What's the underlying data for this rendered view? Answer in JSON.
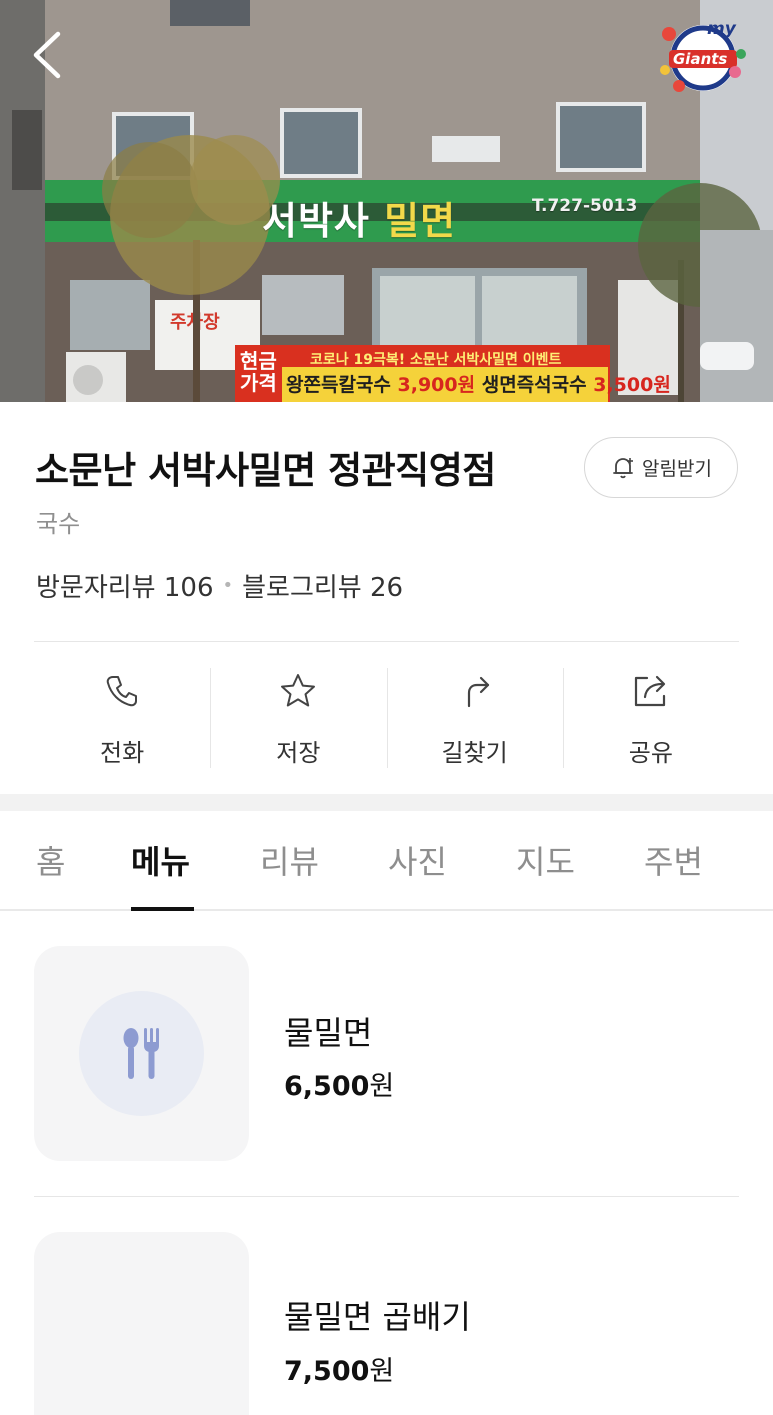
{
  "hero": {
    "sign_name_part1": "서박사 ",
    "sign_name_part2": "밀면",
    "sign_phone": "T.727-5013",
    "banner_top": "코로나 19극복! 소문난 서박사밀면 이벤트",
    "banner_item1": "왕쫀득칼국수 ",
    "banner_price1": "3,900원",
    "banner_item2": "  생면즉석국수 ",
    "banner_price2": "3,500원",
    "banner_cash": "현금 가격",
    "badge_text_top": "my",
    "badge_text_main": "Giants",
    "back_icon": "chevron-left-icon"
  },
  "store": {
    "name": "소문난 서박사밀면 정관직영점",
    "category": "국수",
    "visitor_reviews": "방문자리뷰 106",
    "separator": "•",
    "blog_reviews": "블로그리뷰 26",
    "notify_label": "알림받기",
    "notify_icon": "bell-plus-icon"
  },
  "actions": [
    {
      "label": "전화",
      "icon": "phone-icon"
    },
    {
      "label": "저장",
      "icon": "star-icon"
    },
    {
      "label": "길찾기",
      "icon": "directions-arrow-icon"
    },
    {
      "label": "공유",
      "icon": "share-icon"
    }
  ],
  "tabs": [
    {
      "label": "홈",
      "active": false
    },
    {
      "label": "메뉴",
      "active": true
    },
    {
      "label": "리뷰",
      "active": false
    },
    {
      "label": "사진",
      "active": false
    },
    {
      "label": "지도",
      "active": false
    },
    {
      "label": "주변",
      "active": false
    }
  ],
  "menu": [
    {
      "name": "물밀면",
      "price": "6,500",
      "currency": "원",
      "thumb_icon": "utensils-icon"
    },
    {
      "name": "물밀면 곱배기",
      "price": "7,500",
      "currency": "원",
      "thumb_icon": ""
    }
  ],
  "colors": {
    "sign_green": "#2f9b4e",
    "banner_red": "#d9301f",
    "banner_yellow": "#f5d23a",
    "thumb_bg": "#f5f5f6",
    "icon_circle": "#e9ecf4",
    "utensil_blue": "#8d9bd1"
  }
}
